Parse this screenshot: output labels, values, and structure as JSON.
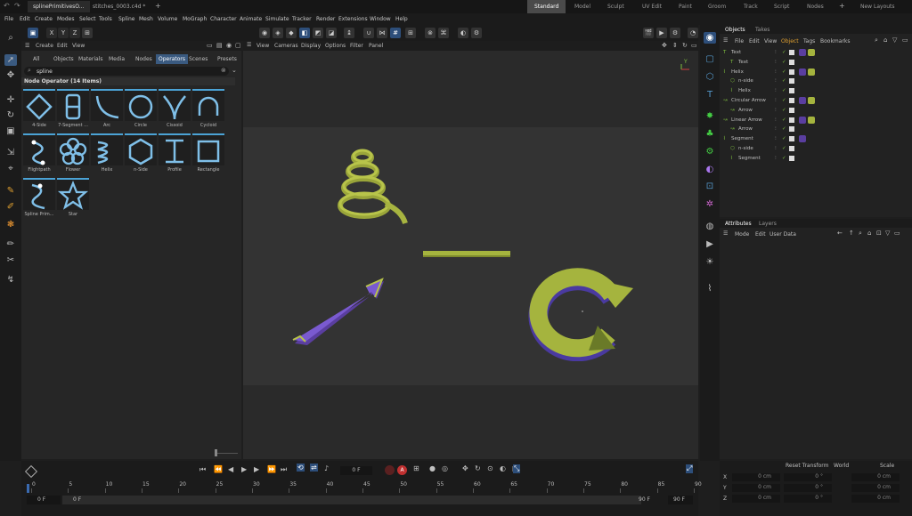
{
  "titlebar": {
    "tabs": [
      {
        "label": "splinePrimitivesO..."
      },
      {
        "label": "stitches_0003.c4d *"
      }
    ],
    "plus": "+",
    "layouts": [
      "Standard",
      "Model",
      "Sculpt",
      "UV Edit",
      "Paint",
      "Groom",
      "Track",
      "Script",
      "Nodes"
    ],
    "new_layouts": "New Layouts",
    "active_layout": "Standard"
  },
  "menubar": [
    "File",
    "Edit",
    "Create",
    "Modes",
    "Select",
    "Tools",
    "Spline",
    "Mesh",
    "Volume",
    "MoGraph",
    "Character",
    "Animate",
    "Simulate",
    "Tracker",
    "Render",
    "Extensions",
    "Window",
    "Help"
  ],
  "axes": {
    "x": "X",
    "y": "Y",
    "z": "Z"
  },
  "asset_browser": {
    "menu": [
      "Create",
      "Edit",
      "View"
    ],
    "tabs": [
      "All",
      "Objects",
      "Materials",
      "Media",
      "Nodes",
      "Operators",
      "Scenes",
      "Presets"
    ],
    "active_tab": "Operators",
    "search_value": "spline",
    "group_title": "Node Operator (14 Items)",
    "items": [
      {
        "label": "4-Side",
        "icon": "diamond-icon"
      },
      {
        "label": "7-Segment ...",
        "icon": "seven-segment-icon"
      },
      {
        "label": "Arc",
        "icon": "arc-icon"
      },
      {
        "label": "Circle",
        "icon": "circle-icon"
      },
      {
        "label": "Cissoid",
        "icon": "cissoid-icon"
      },
      {
        "label": "Cycloid",
        "icon": "cycloid-icon"
      },
      {
        "label": "Flightpath",
        "icon": "flightpath-icon"
      },
      {
        "label": "Flower",
        "icon": "flower-icon"
      },
      {
        "label": "Helix",
        "icon": "helix-icon"
      },
      {
        "label": "n-Side",
        "icon": "hexagon-icon"
      },
      {
        "label": "Profile",
        "icon": "profile-icon"
      },
      {
        "label": "Rectangle",
        "icon": "rectangle-icon"
      },
      {
        "label": "Spline Prim...",
        "icon": "spline-primitive-icon"
      },
      {
        "label": "Star",
        "icon": "star-icon"
      }
    ]
  },
  "viewport": {
    "menu": [
      "View",
      "Cameras",
      "Display",
      "Options",
      "Filter",
      "Panel"
    ],
    "axis_y": "Y"
  },
  "objects_panel": {
    "tabs": [
      "Objects",
      "Takes"
    ],
    "menu": [
      "File",
      "Edit",
      "View",
      "Object",
      "Tags",
      "Bookmarks"
    ],
    "rows": [
      {
        "name": "Text",
        "indent": 0
      },
      {
        "name": "Text",
        "indent": 1
      },
      {
        "name": "Helix",
        "indent": 0
      },
      {
        "name": "n-side",
        "indent": 1
      },
      {
        "name": "Helix",
        "indent": 1
      },
      {
        "name": "Circular Arrow",
        "indent": 0
      },
      {
        "name": "Arrow",
        "indent": 1
      },
      {
        "name": "Linear Arrow",
        "indent": 0
      },
      {
        "name": "Arrow",
        "indent": 1
      },
      {
        "name": "Segment",
        "indent": 0
      },
      {
        "name": "n-side",
        "indent": 1
      },
      {
        "name": "Segment",
        "indent": 1
      }
    ]
  },
  "attributes_panel": {
    "tabs": [
      "Attributes",
      "Layers"
    ],
    "menu": [
      "Mode",
      "Edit",
      "User Data"
    ]
  },
  "timeline": {
    "frame_field": "0 F",
    "ticks": [
      "0",
      "5",
      "10",
      "15",
      "20",
      "25",
      "30",
      "35",
      "40",
      "45",
      "50",
      "55",
      "60",
      "65",
      "70",
      "75",
      "80",
      "85",
      "90"
    ],
    "start": "0 F",
    "start2": "0 F",
    "end": "90 F",
    "end2": "90 F"
  },
  "coords": {
    "buttons": [
      "Reset Transform",
      "World",
      "Scale"
    ],
    "rows": [
      {
        "axis": "X",
        "a": "0 cm",
        "b": "0 °",
        "c": "0 cm"
      },
      {
        "axis": "Y",
        "a": "0 cm",
        "b": "0 °",
        "c": "0 cm"
      },
      {
        "axis": "Z",
        "a": "0 cm",
        "b": "0 °",
        "c": "0 cm"
      }
    ]
  }
}
